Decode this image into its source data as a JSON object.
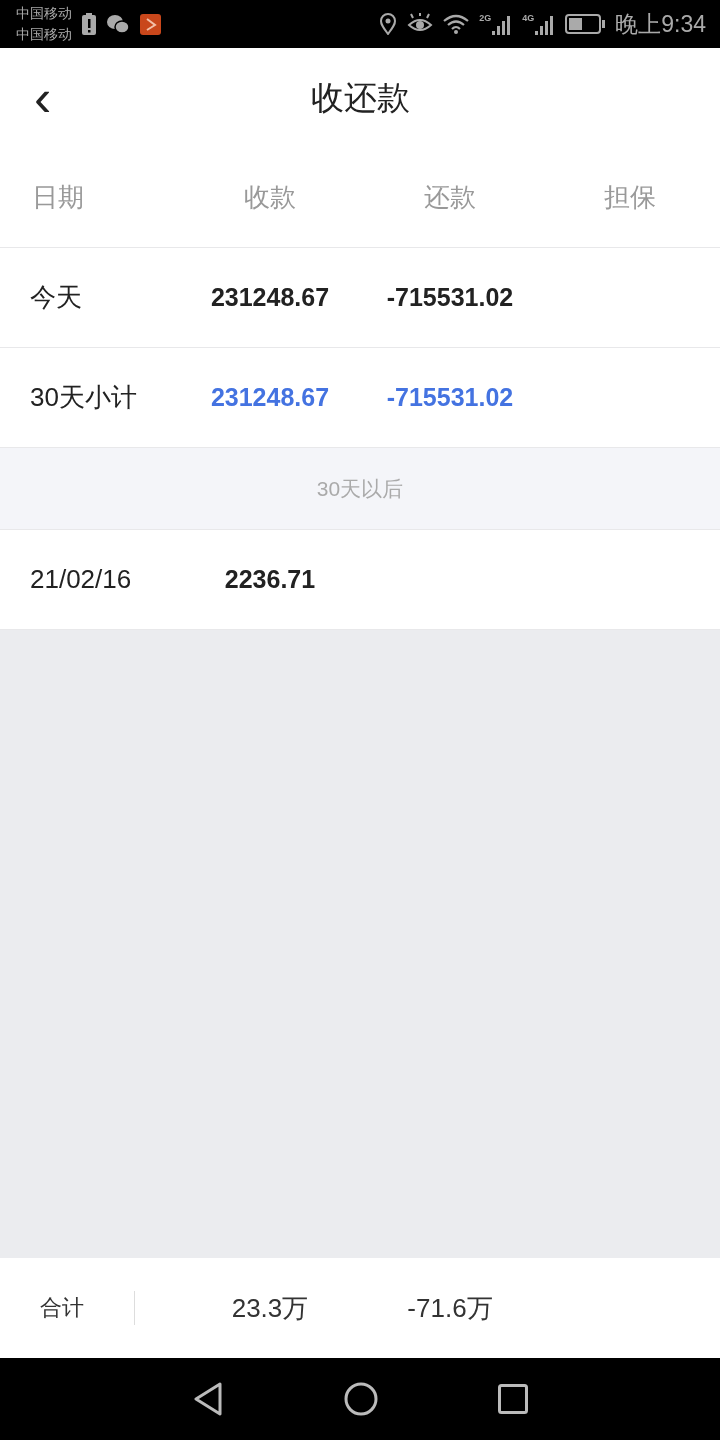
{
  "status_bar": {
    "carriers": [
      "中国移动",
      "中国移动"
    ],
    "network_labels": [
      "2G",
      "4G"
    ],
    "time": "晚上9:34"
  },
  "header": {
    "back": "‹",
    "title": "收还款"
  },
  "columns": [
    "日期",
    "收款",
    "还款",
    "担保"
  ],
  "rows": [
    {
      "kind": "normal",
      "label": "今天",
      "values": [
        "231248.67",
        "-715531.02"
      ]
    },
    {
      "kind": "subtotal",
      "label": "30天小计",
      "values": [
        "231248.67",
        "-715531.02"
      ]
    }
  ],
  "section": {
    "title": "30天以后"
  },
  "later_rows": [
    {
      "label": "21/02/16",
      "values": [
        "2236.71"
      ]
    }
  ],
  "footer": {
    "label": "合计",
    "values": [
      "23.3万",
      "-71.6万"
    ]
  }
}
